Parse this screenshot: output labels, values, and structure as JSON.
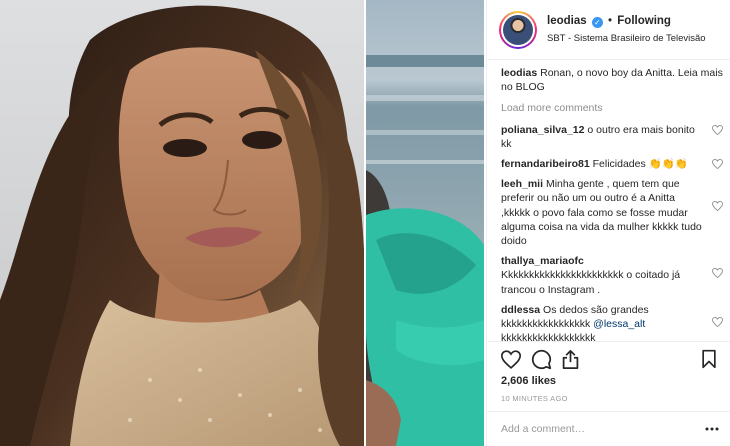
{
  "post": {
    "username": "leodias",
    "follow_status": "Following",
    "location": "SBT - Sistema Brasileiro de Televisão",
    "caption_user": "leodias",
    "caption_text": "Ronan, o novo boy da Anitta. Leia mais no BLOG",
    "load_more": "Load more comments",
    "comments": [
      {
        "user": "poliana_silva_12",
        "text": "o outro era mais bonito kk"
      },
      {
        "user": "fernandaribeiro81",
        "text": "Felicidades 👏👏👏"
      },
      {
        "user": "leeh_mii",
        "text": "Minha gente , quem tem que preferir ou não um ou outro é a Anitta ,kkkkk o povo fala como se fosse mudar alguma coisa na vida da mulher kkkkk tudo doido"
      },
      {
        "user": "thallya_mariaofc",
        "text": "Kkkkkkkkkkkkkkkkkkkkkkk o coitado já trancou o Instagram ."
      },
      {
        "user": "ddlessa",
        "text": "Os dedos são grandes kkkkkkkkkkkkkkkkk",
        "mention": "@lessa_alt",
        "tail": "kkkkkkkkkkkkkkkkkk"
      }
    ],
    "likes": "2,606 likes",
    "time_ago": "10 MINUTES AGO",
    "add_comment_placeholder": "Add a comment…"
  },
  "icons": {
    "verified": "verified-badge-icon",
    "heart": "heart-icon",
    "comment": "comment-icon",
    "share": "share-icon",
    "bookmark": "bookmark-icon",
    "more": "more-options-icon"
  },
  "colors": {
    "verified_blue": "#3897f0",
    "muted_gray": "#8e8e8e",
    "border": "#efefef"
  }
}
